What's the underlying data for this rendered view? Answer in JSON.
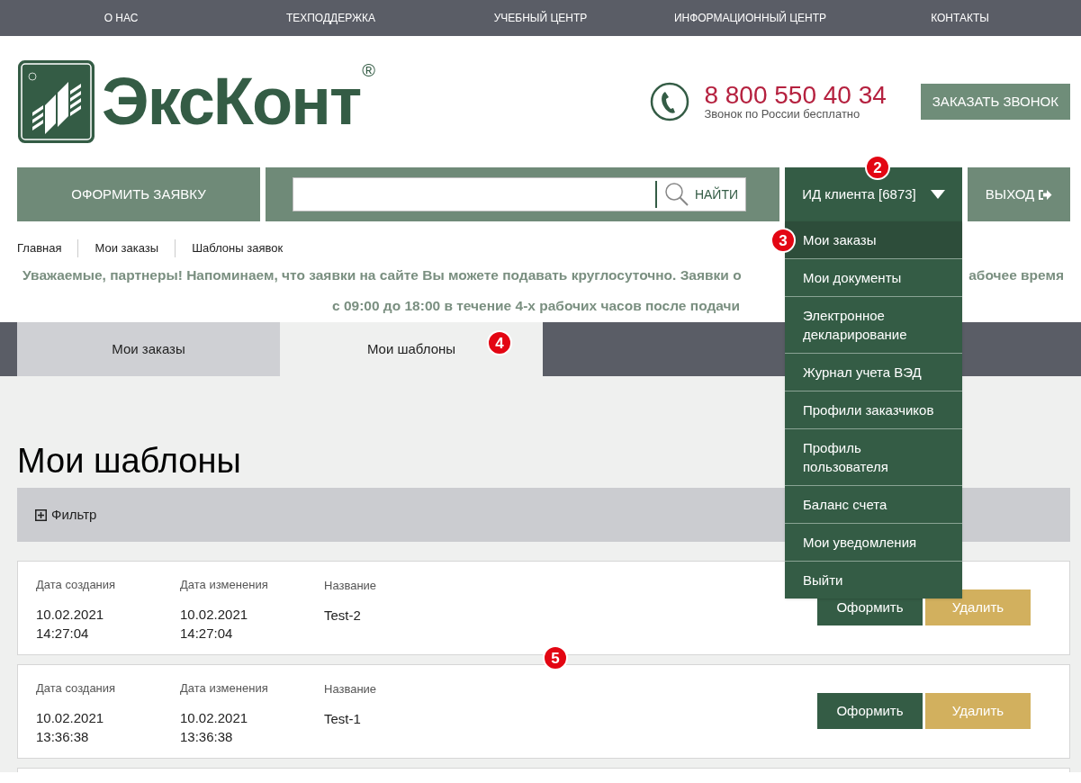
{
  "top_menu": [
    "О НАС",
    "ТЕХПОДДЕРЖКА",
    "УЧЕБНЫЙ ЦЕНТР",
    "ИНФОРМАЦИОННЫЙ ЦЕНТР",
    "КОНТАКТЫ"
  ],
  "logo": {
    "text": "ЭксКонт",
    "mark": "®"
  },
  "phone": {
    "number": "8 800 550 40 34",
    "note": "Звонок по России бесплатно"
  },
  "callback_button": "ЗАКАЗАТЬ ЗВОНОК",
  "nav": {
    "order_button": "ОФОРМИТЬ ЗАЯВКУ",
    "search_button": "НАЙТИ",
    "client": {
      "label": "ИД клиента [6873]",
      "expanded": true
    },
    "exit": "ВЫХОД"
  },
  "client_menu": [
    {
      "label": "Мои заказы",
      "selected": true
    },
    {
      "label": "Мои документы",
      "selected": false
    },
    {
      "label": "Электронное декларирование",
      "selected": false
    },
    {
      "label": "Журнал учета ВЭД",
      "selected": false
    },
    {
      "label": "Профили заказчиков",
      "selected": false
    },
    {
      "label": "Профиль пользователя",
      "selected": false
    },
    {
      "label": "Баланс счета",
      "selected": false
    },
    {
      "label": "Мои уведомления",
      "selected": false
    },
    {
      "label": "Выйти",
      "selected": false
    }
  ],
  "breadcrumbs": [
    "Главная",
    "Мои заказы",
    "Шаблоны заявок"
  ],
  "notice": {
    "line1_left": "Уважаемые, партнеры! Напоминаем, что заявки на сайте Вы можете подавать круглосуточно. Заявки о",
    "line1_right": "абочее время",
    "line2": "с 09:00 до 18:00 в течение 4-х рабочих часов после подачи"
  },
  "tabs": [
    {
      "label": "Мои заказы",
      "selected": false
    },
    {
      "label": "Мои шаблоны",
      "selected": true
    }
  ],
  "heading": "Мои шаблоны",
  "filter": {
    "label": "Фильтр",
    "expanded": false
  },
  "templates": [
    {
      "created_label": "Дата создания",
      "created_date": "10.02.2021",
      "created_time": "14:27:04",
      "changed_label": "Дата изменения",
      "changed_date": "10.02.2021",
      "changed_time": "14:27:04",
      "name_label": "Название",
      "name": "Test-2",
      "actions": [
        "Оформить",
        "Удалить"
      ]
    },
    {
      "created_label": "Дата создания",
      "created_date": "10.02.2021",
      "created_time": "13:36:38",
      "changed_label": "Дата изменения",
      "changed_date": "10.02.2021",
      "changed_time": "13:36:38",
      "name_label": "Название",
      "name": "Test-1",
      "actions": [
        "Оформить",
        "Удалить"
      ]
    }
  ],
  "markers": [
    "2",
    "3",
    "4",
    "5"
  ]
}
